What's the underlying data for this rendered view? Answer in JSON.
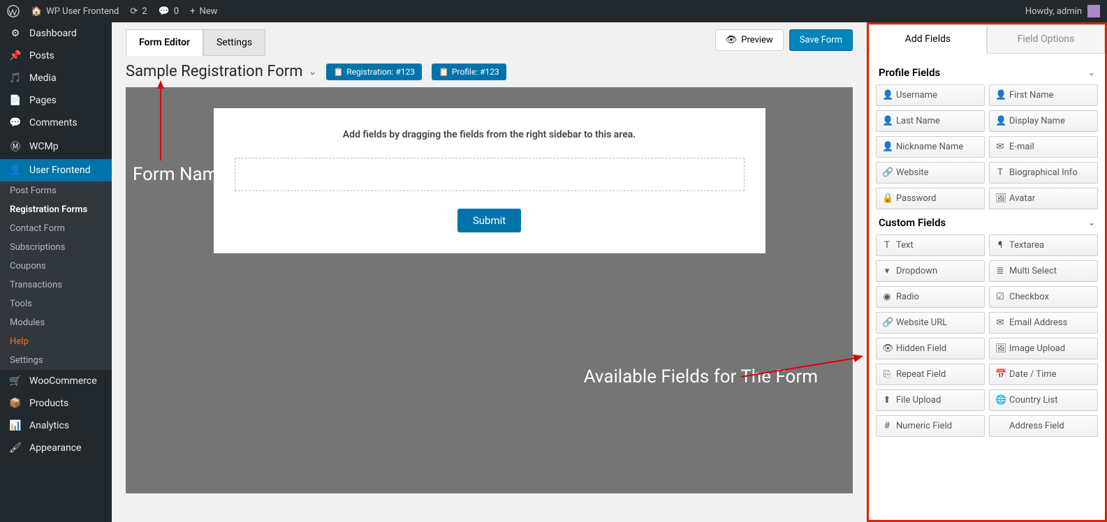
{
  "topbar": {
    "site_name": "WP User Frontend",
    "updates": "2",
    "comments": "0",
    "new": "New",
    "greeting": "Howdy, admin"
  },
  "sidebar": {
    "items": [
      {
        "label": "Dashboard",
        "icon": "dashboard"
      },
      {
        "label": "Posts",
        "icon": "pin"
      },
      {
        "label": "Media",
        "icon": "media"
      },
      {
        "label": "Pages",
        "icon": "pages"
      },
      {
        "label": "Comments",
        "icon": "comment"
      },
      {
        "label": "WCMp",
        "icon": "wcmp"
      },
      {
        "label": "User Frontend",
        "icon": "uf",
        "active": true
      },
      {
        "label": "WooCommerce",
        "icon": "woo"
      },
      {
        "label": "Products",
        "icon": "products"
      },
      {
        "label": "Analytics",
        "icon": "analytics"
      },
      {
        "label": "Appearance",
        "icon": "appearance"
      }
    ],
    "sub": [
      {
        "label": "Post Forms"
      },
      {
        "label": "Registration Forms",
        "current": true
      },
      {
        "label": "Contact Form"
      },
      {
        "label": "Subscriptions"
      },
      {
        "label": "Coupons"
      },
      {
        "label": "Transactions"
      },
      {
        "label": "Tools"
      },
      {
        "label": "Modules"
      },
      {
        "label": "Help",
        "highlight": true
      },
      {
        "label": "Settings"
      }
    ]
  },
  "tabs": {
    "form_editor": "Form Editor",
    "settings": "Settings"
  },
  "header": {
    "form_title": "Sample Registration Form",
    "reg_badge": "Registration: #123",
    "profile_badge": "Profile: #123"
  },
  "actions": {
    "preview": "Preview",
    "save": "Save Form"
  },
  "canvas": {
    "hint": "Add fields by dragging the fields from the right sidebar to this area.",
    "submit": "Submit"
  },
  "annotations": {
    "form_name": "Form Name",
    "available_fields": "Available Fields for The Form"
  },
  "panel": {
    "tabs": {
      "add": "Add Fields",
      "options": "Field Options"
    },
    "sections": [
      {
        "title": "Profile Fields",
        "fields": [
          {
            "icon": "👤",
            "label": "Username"
          },
          {
            "icon": "👤",
            "label": "First Name"
          },
          {
            "icon": "👤",
            "label": "Last Name"
          },
          {
            "icon": "👤",
            "label": "Display Name"
          },
          {
            "icon": "👤",
            "label": "Nickname Name"
          },
          {
            "icon": "✉",
            "label": "E-mail"
          },
          {
            "icon": "🔗",
            "label": "Website"
          },
          {
            "icon": "T",
            "label": "Biographical Info"
          },
          {
            "icon": "🔒",
            "label": "Password"
          },
          {
            "icon": "🖼",
            "label": "Avatar"
          }
        ]
      },
      {
        "title": "Custom Fields",
        "fields": [
          {
            "icon": "T",
            "label": "Text"
          },
          {
            "icon": "¶",
            "label": "Textarea"
          },
          {
            "icon": "▾",
            "label": "Dropdown"
          },
          {
            "icon": "≣",
            "label": "Multi Select"
          },
          {
            "icon": "◉",
            "label": "Radio"
          },
          {
            "icon": "☑",
            "label": "Checkbox"
          },
          {
            "icon": "🔗",
            "label": "Website URL"
          },
          {
            "icon": "✉",
            "label": "Email Address"
          },
          {
            "icon": "👁",
            "label": "Hidden Field"
          },
          {
            "icon": "🖼",
            "label": "Image Upload"
          },
          {
            "icon": "⎘",
            "label": "Repeat Field"
          },
          {
            "icon": "📅",
            "label": "Date / Time"
          },
          {
            "icon": "⬆",
            "label": "File Upload"
          },
          {
            "icon": "🌐",
            "label": "Country List"
          },
          {
            "icon": "#",
            "label": "Numeric Field"
          },
          {
            "icon": "",
            "label": "Address Field"
          }
        ]
      }
    ]
  }
}
